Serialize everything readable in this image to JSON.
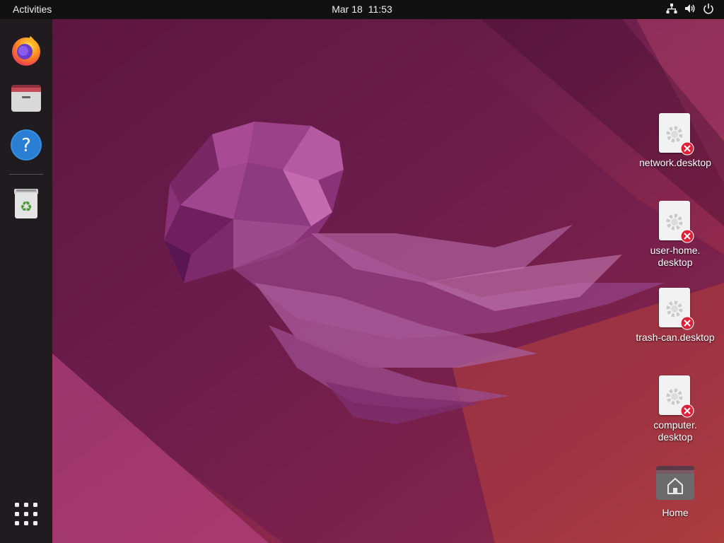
{
  "topbar": {
    "activities_label": "Activities",
    "date": "Mar 18",
    "time": "11:53",
    "tray_icons": [
      "network-icon",
      "volume-icon",
      "power-icon"
    ]
  },
  "dock": {
    "items": [
      {
        "name": "Firefox",
        "icon": "firefox-icon"
      },
      {
        "name": "Files",
        "icon": "files-icon"
      },
      {
        "name": "Help",
        "icon": "help-icon"
      },
      {
        "name": "Trash",
        "icon": "trash-icon"
      }
    ],
    "show_apps_icon": "app-grid-icon"
  },
  "desktop": {
    "icons": [
      {
        "label": "network.desktop",
        "type": "broken-launcher"
      },
      {
        "label_line1": "user-home.",
        "label_line2": "desktop",
        "type": "broken-launcher"
      },
      {
        "label": "trash-can.desktop",
        "type": "broken-launcher"
      },
      {
        "label_line1": "computer.",
        "label_line2": "desktop",
        "type": "broken-launcher"
      },
      {
        "label": "Home",
        "type": "folder"
      }
    ]
  },
  "colors": {
    "topbar_bg": "#111111",
    "dock_bg": "#1f1b1e",
    "wallpaper_base": "#5a1a3e",
    "wallpaper_accent": "#e95420",
    "error_badge": "#e0203a"
  }
}
